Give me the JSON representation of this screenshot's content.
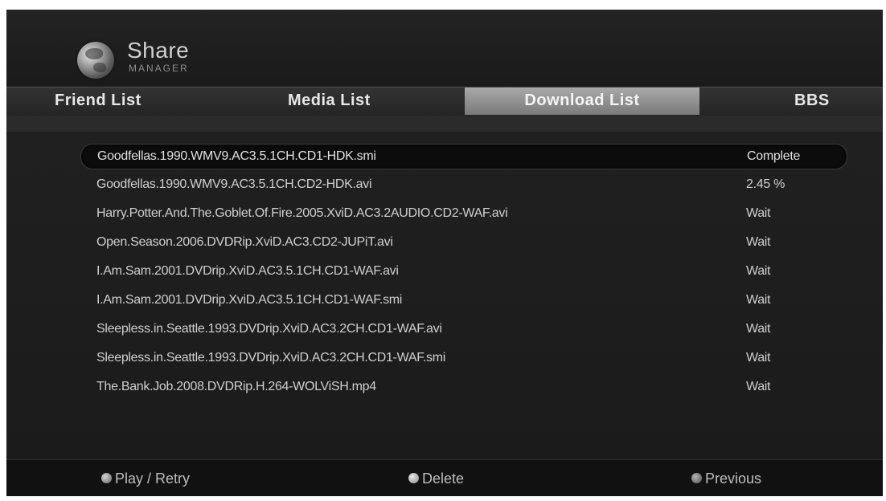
{
  "app": {
    "title": "Share",
    "subtitle": "MANAGER",
    "logo_icon": "globe-icon"
  },
  "tabs": [
    {
      "label": "Friend List",
      "active": false
    },
    {
      "label": "Media List",
      "active": false
    },
    {
      "label": "Download List",
      "active": true
    },
    {
      "label": "BBS",
      "active": false
    }
  ],
  "downloads": [
    {
      "file": "Goodfellas.1990.WMV9.AC3.5.1CH.CD1-HDK.smi",
      "status": "Complete",
      "selected": true
    },
    {
      "file": "Goodfellas.1990.WMV9.AC3.5.1CH.CD2-HDK.avi",
      "status": "2.45 %",
      "selected": false
    },
    {
      "file": "Harry.Potter.And.The.Goblet.Of.Fire.2005.XviD.AC3.2AUDIO.CD2-WAF.avi",
      "status": "Wait",
      "selected": false
    },
    {
      "file": "Open.Season.2006.DVDRip.XviD.AC3.CD2-JUPiT.avi",
      "status": "Wait",
      "selected": false
    },
    {
      "file": "I.Am.Sam.2001.DVDrip.XviD.AC3.5.1CH.CD1-WAF.avi",
      "status": "Wait",
      "selected": false
    },
    {
      "file": "I.Am.Sam.2001.DVDrip.XviD.AC3.5.1CH.CD1-WAF.smi",
      "status": "Wait",
      "selected": false
    },
    {
      "file": "Sleepless.in.Seattle.1993.DVDrip.XviD.AC3.2CH.CD1-WAF.avi",
      "status": "Wait",
      "selected": false
    },
    {
      "file": "Sleepless.in.Seattle.1993.DVDrip.XviD.AC3.2CH.CD1-WAF.smi",
      "status": "Wait",
      "selected": false
    },
    {
      "file": "The.Bank.Job.2008.DVDRip.H.264-WOLViSH.mp4",
      "status": "Wait",
      "selected": false
    }
  ],
  "footer": {
    "play_label": "Play / Retry",
    "delete_label": "Delete",
    "previous_label": "Previous"
  }
}
